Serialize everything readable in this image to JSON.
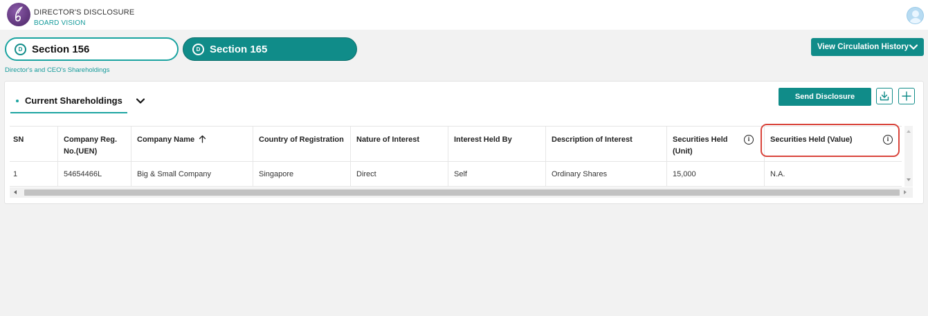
{
  "header": {
    "app_title": "DIRECTOR'S DISCLOSURE",
    "app_subtitle": "BOARD VISION"
  },
  "sections": [
    {
      "badge": "D",
      "label": "Section 156",
      "active": false
    },
    {
      "badge": "D",
      "label": "Section 165",
      "active": true
    }
  ],
  "breadcrumb": "Director's and CEO's Shareholdings",
  "toolbar": {
    "view_history_label": "View Circulation History",
    "send_disclosure_label": "Send Disclosure",
    "download_icon": "download-icon",
    "add_icon": "plus-icon"
  },
  "tab": {
    "label": "Current Shareholdings"
  },
  "table": {
    "columns": [
      "SN",
      "Company Reg. No.(UEN)",
      "Company Name",
      "Country of Registration",
      "Nature of Interest",
      "Interest Held By",
      "Description of Interest",
      "Securities Held (Unit)",
      "Securities Held (Value)"
    ],
    "rows": [
      [
        "1",
        "54654466L",
        "Big & Small Company",
        "Singapore",
        "Direct",
        "Self",
        "Ordinary Shares",
        "15,000",
        "N.A."
      ]
    ]
  },
  "colors": {
    "accent": "#108c89",
    "highlight": "#d9443b",
    "logo": "#5b2d7a"
  }
}
